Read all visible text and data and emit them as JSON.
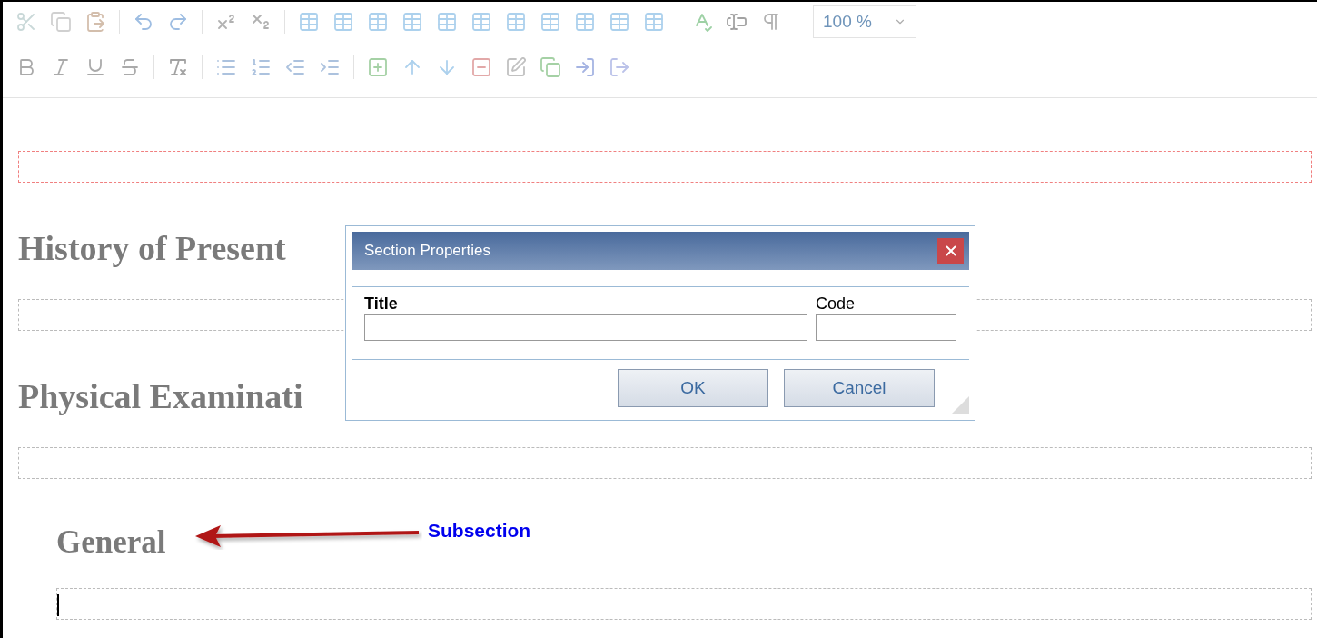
{
  "toolbar": {
    "rows": [
      [
        {
          "kind": "cut"
        },
        {
          "kind": "copy"
        },
        {
          "kind": "paste"
        },
        {
          "kind": "separator"
        },
        {
          "kind": "undo"
        },
        {
          "kind": "redo"
        },
        {
          "kind": "separator"
        },
        {
          "kind": "superscript"
        },
        {
          "kind": "subscript"
        },
        {
          "kind": "separator"
        },
        {
          "kind": "table"
        },
        {
          "kind": "table"
        },
        {
          "kind": "table"
        },
        {
          "kind": "table"
        },
        {
          "kind": "table"
        },
        {
          "kind": "table"
        },
        {
          "kind": "table"
        },
        {
          "kind": "table"
        },
        {
          "kind": "table"
        },
        {
          "kind": "table"
        },
        {
          "kind": "table"
        },
        {
          "kind": "separator"
        },
        {
          "kind": "spellcheck"
        },
        {
          "kind": "textfield"
        },
        {
          "kind": "pilcrow"
        }
      ],
      [
        {
          "kind": "bold"
        },
        {
          "kind": "italic"
        },
        {
          "kind": "underline"
        },
        {
          "kind": "strike"
        },
        {
          "kind": "separator"
        },
        {
          "kind": "clearformat"
        },
        {
          "kind": "separator"
        },
        {
          "kind": "bullets"
        },
        {
          "kind": "numbers"
        },
        {
          "kind": "outdent"
        },
        {
          "kind": "indent"
        },
        {
          "kind": "separator"
        },
        {
          "kind": "addsection"
        },
        {
          "kind": "up"
        },
        {
          "kind": "down"
        },
        {
          "kind": "removesection"
        },
        {
          "kind": "editsection"
        },
        {
          "kind": "copysection"
        },
        {
          "kind": "enter"
        },
        {
          "kind": "exit"
        }
      ]
    ],
    "zoom": {
      "value": "100 %"
    }
  },
  "document": {
    "blocks": [
      {
        "kind": "area",
        "highlight": true
      },
      {
        "kind": "heading",
        "text": "History of Present"
      },
      {
        "kind": "area",
        "highlight": false
      },
      {
        "kind": "heading",
        "text": "Physical Examinati"
      },
      {
        "kind": "area",
        "highlight": false
      },
      {
        "kind": "subheading",
        "text": "General"
      },
      {
        "kind": "area",
        "highlight": false,
        "sub": true,
        "cursor": true
      }
    ]
  },
  "annotation": {
    "label": "Subsection"
  },
  "dialog": {
    "title": "Section Properties",
    "fields": [
      {
        "label": "Title",
        "kind": "wide"
      },
      {
        "label": "Code",
        "kind": "narrow"
      }
    ],
    "buttons": [
      "OK",
      "Cancel"
    ]
  }
}
